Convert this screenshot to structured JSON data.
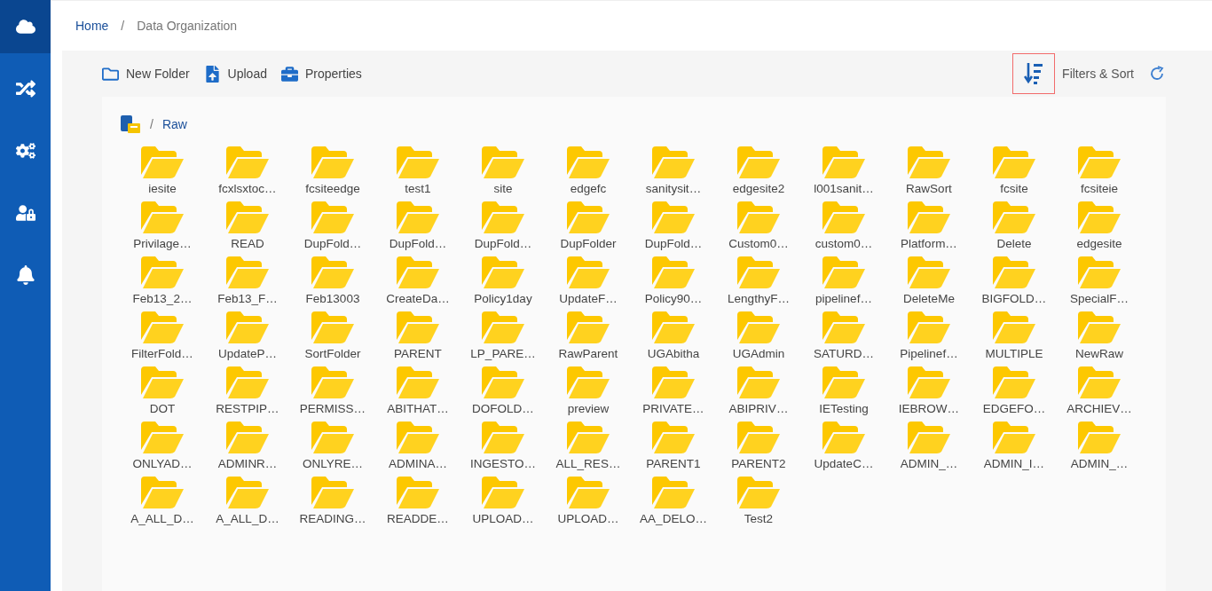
{
  "sidebar": {
    "items": [
      {
        "kind": "cloud",
        "selected": true
      },
      {
        "kind": "flow",
        "selected": false
      },
      {
        "kind": "gear",
        "selected": false
      },
      {
        "kind": "userlock",
        "selected": false
      },
      {
        "kind": "bell",
        "selected": false
      }
    ]
  },
  "breadcrumb": [
    "Home",
    "/",
    "Data Organization"
  ],
  "toolbar": {
    "actions": [
      {
        "kind": "folder",
        "label": "New Folder"
      },
      {
        "kind": "upload",
        "label": "Upload"
      },
      {
        "kind": "properties",
        "label": "Properties"
      }
    ],
    "sort_button": {
      "focused": true
    },
    "filters_label": "Filters & Sort"
  },
  "path": {
    "separator": "/",
    "current": "Raw"
  },
  "folders": [
    "iesite",
    "fcxlsxtoc…",
    "fcsiteedge",
    "test1",
    "site",
    "edgefc",
    "sanitysit…",
    "edgesite2",
    "l001sanit…",
    "RawSort",
    "fcsite",
    "fcsiteie",
    "Privilage…",
    "READ",
    "DupFold…",
    "DupFold…",
    "DupFold…",
    "DupFolder",
    "DupFold…",
    "Custom0…",
    "custom0…",
    "Platform…",
    "Delete",
    "edgesite",
    "Feb13_2…",
    "Feb13_F…",
    "Feb13003",
    "CreateDa…",
    "Policy1day",
    "UpdateF…",
    "Policy90…",
    "LengthyF…",
    "pipelinef…",
    "DeleteMe",
    "BIGFOLD…",
    "SpecialF…",
    "FilterFold…",
    "UpdateP…",
    "SortFolder",
    "PARENT",
    "LP_PARE…",
    "RawParent",
    "UGAbitha",
    "UGAdmin",
    "SATURD…",
    "Pipelinef…",
    "MULTIPLE",
    "NewRaw",
    "DOT",
    "RESTPIP…",
    "PERMISS…",
    "ABITHAT…",
    "DOFOLD…",
    "preview",
    "PRIVATE…",
    "ABIPRIV…",
    "IETesting",
    "IEBROW…",
    "EDGEFO…",
    "ARCHIEV…",
    "ONLYAD…",
    "ADMINR…",
    "ONLYRE…",
    "ADMINA…",
    "INGESTO…",
    "ALL_RES…",
    "PARENT1",
    "PARENT2",
    "UpdateC…",
    "ADMIN_…",
    "ADMIN_I…",
    "ADMIN_…",
    "A_ALL_D…",
    "A_ALL_D…",
    "READING…",
    "READDE…",
    "UPLOAD…",
    "UPLOAD…",
    "AA_DELO…",
    "Test2"
  ]
}
